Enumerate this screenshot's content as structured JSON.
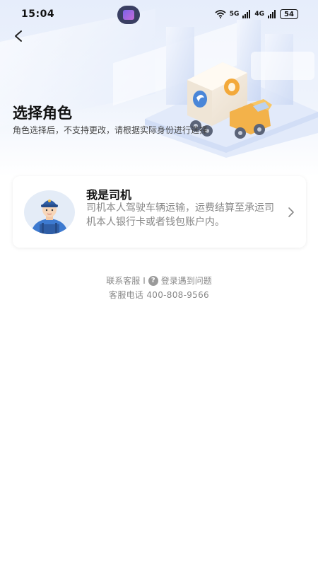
{
  "status_bar": {
    "time": "15:04",
    "net1": "5G",
    "net2": "4G",
    "battery": "54"
  },
  "header": {
    "title": "选择角色",
    "subtitle": "角色选择后，不支持更改，请根据实际身份进行选择"
  },
  "role_card": {
    "title": "我是司机",
    "description": "司机本人驾驶车辆运输，运费结算至承运司机本人银行卡或者钱包账户内。"
  },
  "footer": {
    "contact_label": "联系客服",
    "separator": "I",
    "help_glyph": "?",
    "login_help_label": "登录遇到问题",
    "phone_text": "客服电话 400-808-9566"
  },
  "colors": {
    "accent_blue": "#4a86d8",
    "truck_orange": "#f3a93a"
  }
}
